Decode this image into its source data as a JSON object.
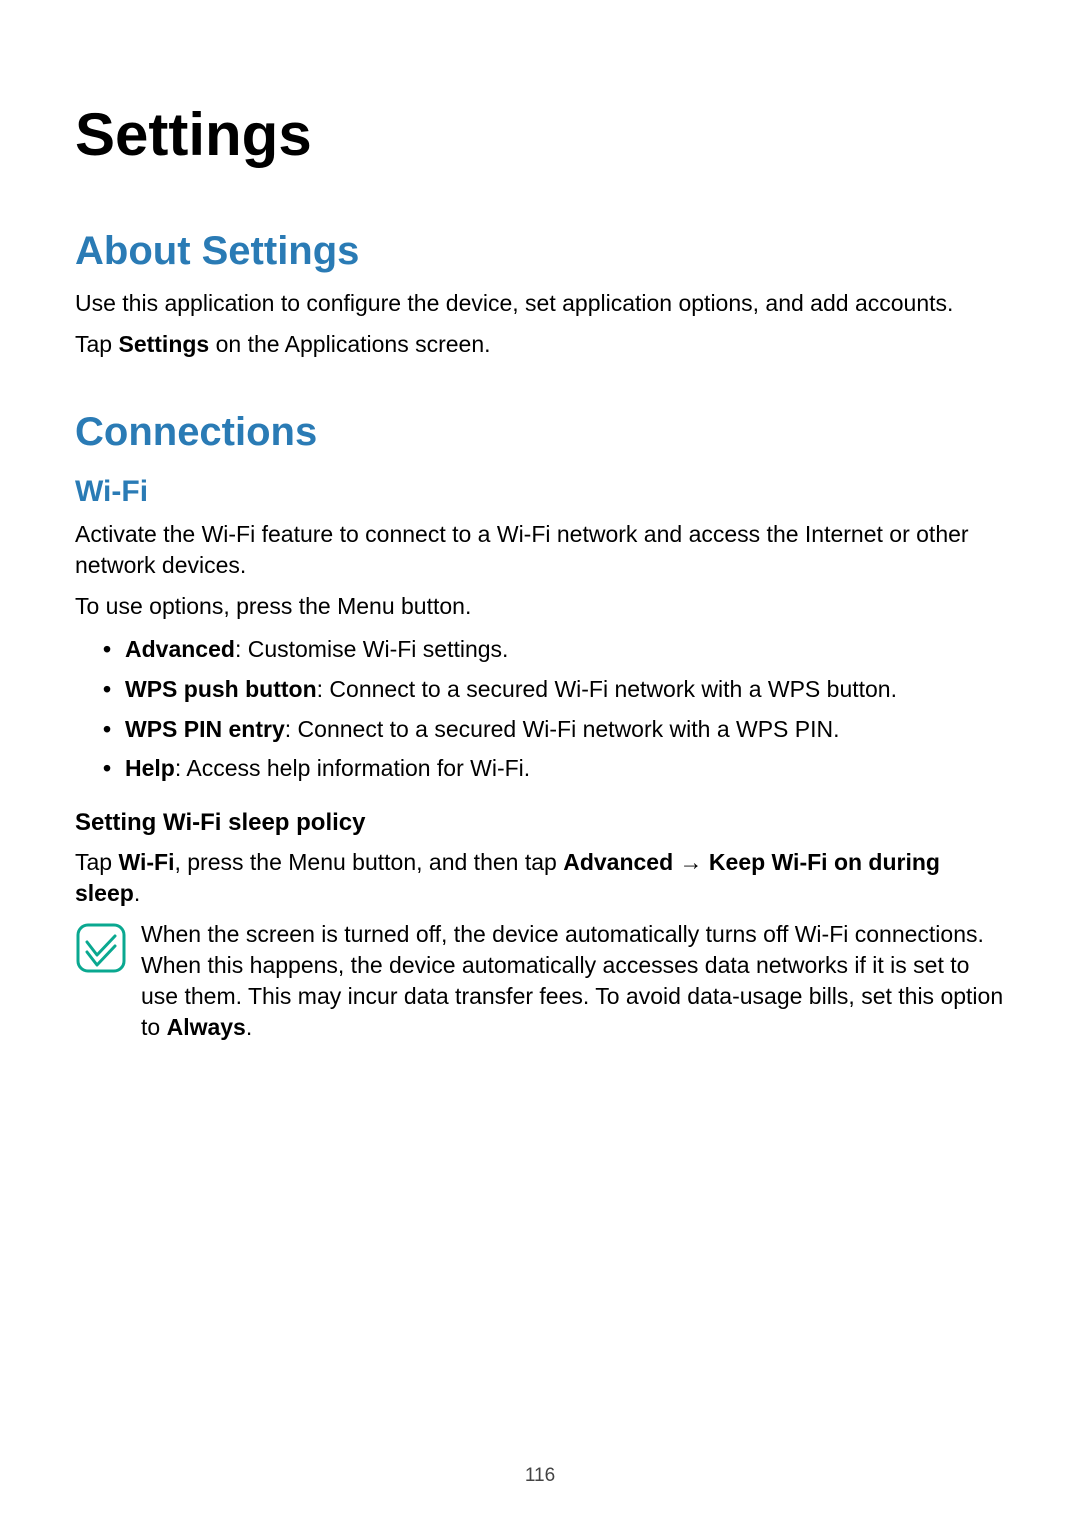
{
  "page_number": "116",
  "title": "Settings",
  "about": {
    "heading": "About Settings",
    "p1": "Use this application to configure the device, set application options, and add accounts.",
    "p2_pre": "Tap ",
    "p2_bold": "Settings",
    "p2_post": " on the Applications screen."
  },
  "connections": {
    "heading": "Connections",
    "wifi": {
      "heading": "Wi-Fi",
      "p1": "Activate the Wi-Fi feature to connect to a Wi-Fi network and access the Internet or other network devices.",
      "p2": "To use options, press the Menu button.",
      "options": [
        {
          "bold": "Advanced",
          "rest": ": Customise Wi-Fi settings."
        },
        {
          "bold": "WPS push button",
          "rest": ": Connect to a secured Wi-Fi network with a WPS button."
        },
        {
          "bold": "WPS PIN entry",
          "rest": ": Connect to a secured Wi-Fi network with a WPS PIN."
        },
        {
          "bold": "Help",
          "rest": ": Access help information for Wi-Fi."
        }
      ],
      "sleep": {
        "heading": "Setting Wi-Fi sleep policy",
        "line_pre": "Tap ",
        "line_b1": "Wi-Fi",
        "line_mid1": ", press the Menu button, and then tap ",
        "line_b2": "Advanced",
        "line_arrow": " → ",
        "line_b3": "Keep Wi-Fi on during sleep",
        "line_post": ".",
        "note_body": "When the screen is turned off, the device automatically turns off Wi-Fi connections. When this happens, the device automatically accesses data networks if it is set to use them. This may incur data transfer fees. To avoid data-usage bills, set this option to ",
        "note_bold": "Always",
        "note_post": "."
      }
    }
  },
  "colors": {
    "heading_blue": "#2a7bb5",
    "note_icon_teal": "#0aa890"
  }
}
